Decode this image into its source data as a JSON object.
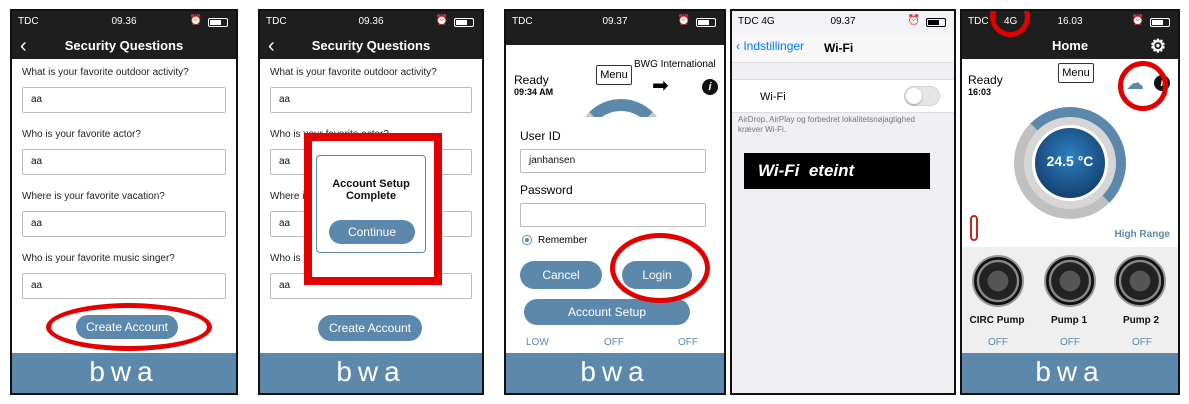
{
  "footer_logo": "bwa",
  "phone1": {
    "carrier": "TDC",
    "time": "09.36",
    "title": "Security Questions",
    "questions": [
      {
        "label": "What is your favorite outdoor activity?",
        "answer": "aa"
      },
      {
        "label": "Who is your favorite actor?",
        "answer": "aa"
      },
      {
        "label": "Where is your favorite vacation?",
        "answer": "aa"
      },
      {
        "label": "Who is your favorite music singer?",
        "answer": "aa"
      }
    ],
    "create_label": "Create Account"
  },
  "phone2": {
    "carrier": "TDC",
    "time": "09.36",
    "title": "Security Questions",
    "questions": [
      {
        "label": "What is your favorite outdoor activity?",
        "answer": "aa"
      },
      {
        "label": "Who is your favorite actor?",
        "answer": "aa"
      },
      {
        "label": "Where is your favorite vacation?",
        "answer": "aa"
      },
      {
        "label": "Who is your favorite music singer?",
        "answer": "aa"
      }
    ],
    "create_label": "Create Account",
    "dialog_title": "Account Setup Complete",
    "dialog_button": "Continue"
  },
  "phone3": {
    "carrier": "TDC",
    "time": "09.37",
    "ready": "Ready",
    "ready_time": "09:34 AM",
    "menu": "Menu",
    "brand": "BWG International",
    "user_label": "User ID",
    "user_value": "janhansen",
    "password_label": "Password",
    "remember": "Remember",
    "cancel": "Cancel",
    "login": "Login",
    "account_setup": "Account Setup",
    "lows": [
      "LOW",
      "OFF",
      "OFF"
    ]
  },
  "phone4": {
    "carrier": "TDC 4G",
    "time": "09.37",
    "back_label": "Indstillinger",
    "title": "Wi-Fi",
    "wifi_label": "Wi-Fi",
    "note": "AirDrop, AirPlay og forbedret lokalitetsnøjagtighed kræver Wi-Fi.",
    "banner": "Wi-Fi  eteint"
  },
  "phone5": {
    "carrier": "TDC",
    "network": "4G",
    "time": "16.03",
    "title": "Home",
    "ready": "Ready",
    "ready_time": "16:03",
    "menu": "Menu",
    "temp": "24.5 °C",
    "range": "High Range",
    "pumps": [
      {
        "name": "CIRC Pump",
        "state": "OFF"
      },
      {
        "name": "Pump 1",
        "state": "OFF"
      },
      {
        "name": "Pump 2",
        "state": "OFF"
      }
    ]
  }
}
